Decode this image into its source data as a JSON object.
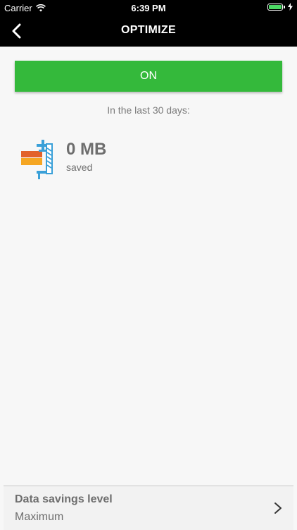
{
  "status_bar": {
    "carrier": "Carrier",
    "time": "6:39 PM",
    "wifi_icon": "wifi-icon",
    "battery_icon": "battery-icon",
    "charging_icon": "charging-bolt-icon"
  },
  "nav": {
    "title": "OPTIMIZE",
    "back_icon": "chevron-left-icon"
  },
  "toggle": {
    "label": "ON",
    "color": "#34b93b"
  },
  "stats": {
    "period_text": "In the last 30 days:",
    "amount": "0 MB",
    "unit_label": "saved",
    "icon": "compress-icon"
  },
  "savings_level": {
    "label": "Data savings level",
    "value": "Maximum",
    "chevron_icon": "chevron-right-icon"
  },
  "colors": {
    "accent_green": "#34b93b",
    "nav_background": "#000000",
    "text_gray": "#6e6e6e"
  }
}
